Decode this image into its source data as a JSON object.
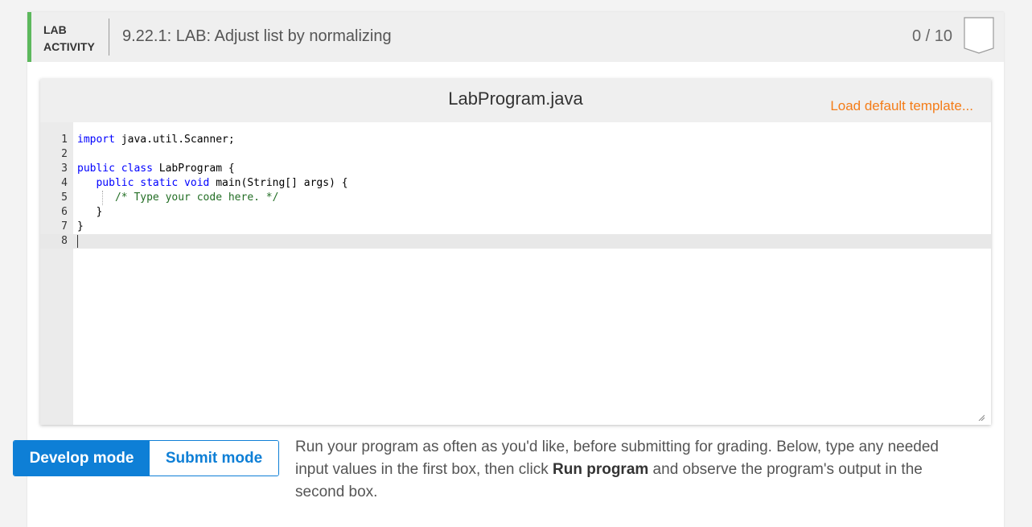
{
  "activity": {
    "label_line1": "LAB",
    "label_line2": "ACTIVITY",
    "title": "9.22.1: LAB: Adjust list by normalizing",
    "score": "0 / 10",
    "accent_color": "#5cb85c"
  },
  "editor": {
    "file_name": "LabProgram.java",
    "load_template_label": "Load default template...",
    "active_line": 8,
    "lines": [
      {
        "num": "1",
        "code": "import java.util.Scanner;"
      },
      {
        "num": "2",
        "code": ""
      },
      {
        "num": "3",
        "code": "public class LabProgram {"
      },
      {
        "num": "4",
        "code": "   public static void main(String[] args) {"
      },
      {
        "num": "5",
        "code": "      /* Type your code here. */"
      },
      {
        "num": "6",
        "code": "   }"
      },
      {
        "num": "7",
        "code": "}"
      },
      {
        "num": "8",
        "code": ""
      }
    ]
  },
  "modes": {
    "develop_label": "Develop mode",
    "submit_label": "Submit mode",
    "selected": "Develop mode",
    "accent_color": "#0e7fd6"
  },
  "instructions": {
    "part1": "Run your program as often as you'd like, before submitting for grading. Below, type any needed input values in the first box, then click ",
    "bold": "Run program",
    "part2": " and observe the program's output in the second box."
  }
}
